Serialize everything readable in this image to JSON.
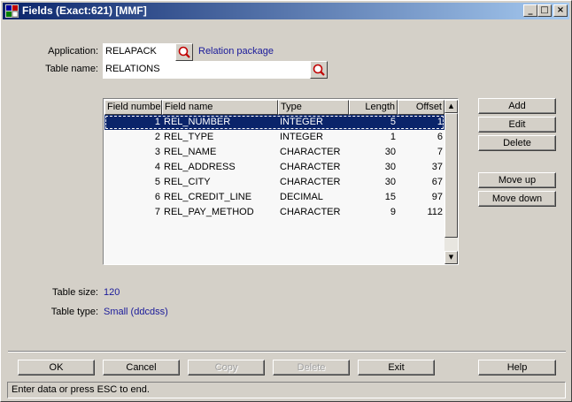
{
  "window": {
    "title": "Fields (Exact:621) [MMF]",
    "controls": {
      "minimize": "_",
      "maximize": "□",
      "close": "×"
    }
  },
  "form": {
    "application_label": "Application:",
    "application_value": "RELAPACK",
    "application_desc": "Relation package",
    "table_name_label": "Table name:",
    "table_name_value": "RELATIONS",
    "table_size_label": "Table size:",
    "table_size_value": "120",
    "table_type_label": "Table type:",
    "table_type_value": "Small (ddcdss)"
  },
  "grid": {
    "columns": [
      "Field number",
      "Field name",
      "Type",
      "Length",
      "Offset"
    ],
    "rows": [
      {
        "num": "1",
        "name": "REL_NUMBER",
        "type": "INTEGER",
        "length": "5",
        "offset": "1",
        "selected": true
      },
      {
        "num": "2",
        "name": "REL_TYPE",
        "type": "INTEGER",
        "length": "1",
        "offset": "6"
      },
      {
        "num": "3",
        "name": "REL_NAME",
        "type": "CHARACTER",
        "length": "30",
        "offset": "7"
      },
      {
        "num": "4",
        "name": "REL_ADDRESS",
        "type": "CHARACTER",
        "length": "30",
        "offset": "37"
      },
      {
        "num": "5",
        "name": "REL_CITY",
        "type": "CHARACTER",
        "length": "30",
        "offset": "67"
      },
      {
        "num": "6",
        "name": "REL_CREDIT_LINE",
        "type": "DECIMAL",
        "length": "15",
        "offset": "97"
      },
      {
        "num": "7",
        "name": "REL_PAY_METHOD",
        "type": "CHARACTER",
        "length": "9",
        "offset": "112"
      }
    ]
  },
  "side_buttons": {
    "add": "Add",
    "edit": "Edit",
    "delete": "Delete",
    "move_up": "Move up",
    "move_down": "Move down"
  },
  "bottom_buttons": {
    "ok": "OK",
    "cancel": "Cancel",
    "copy": "Copy",
    "delete": "Delete",
    "exit": "Exit",
    "help": "Help"
  },
  "status": "Enter data or press ESC to end.",
  "icons": {
    "app": "app-window-icon",
    "lookup": "magnifier-icon"
  },
  "colors": {
    "face": "#d4d0c8",
    "title_start": "#0a246a",
    "title_end": "#a6caf0",
    "selection": "#0a246a",
    "link_text": "#1a1a9a"
  }
}
